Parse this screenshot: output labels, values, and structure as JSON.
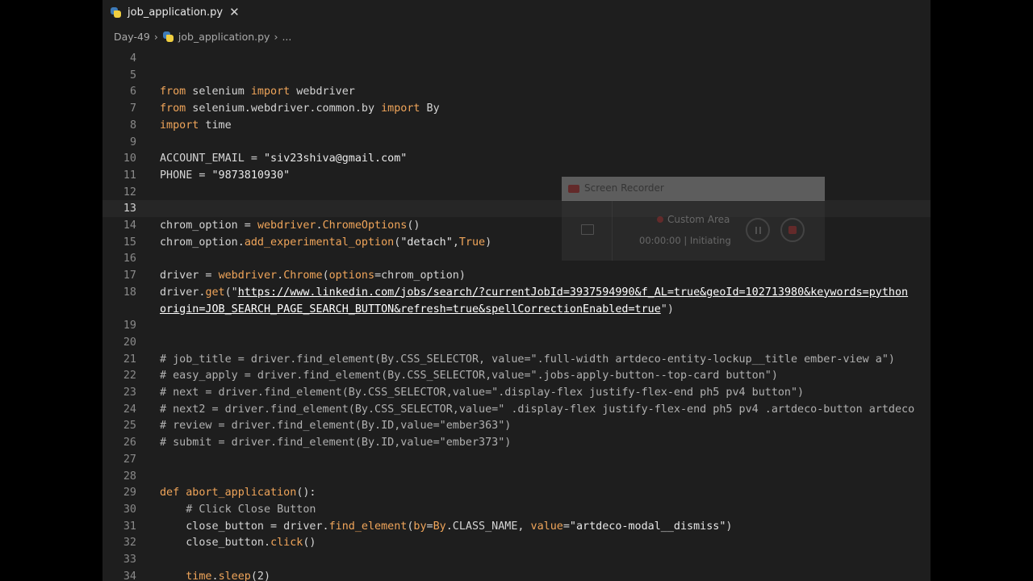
{
  "tab": {
    "filename": "job_application.py",
    "close_glyph": "✕",
    "icon": "python-icon"
  },
  "breadcrumb": {
    "folder": "Day-49",
    "file": "job_application.py",
    "chevron": "›",
    "ellipsis": "..."
  },
  "active_line": 13,
  "lines": [
    {
      "n": "4",
      "tokens": []
    },
    {
      "n": "5",
      "tokens": []
    },
    {
      "n": "6",
      "tokens": [
        [
          "kw",
          "from"
        ],
        [
          "p",
          " selenium "
        ],
        [
          "kw",
          "import"
        ],
        [
          "p",
          " webdriver"
        ]
      ]
    },
    {
      "n": "7",
      "tokens": [
        [
          "kw",
          "from"
        ],
        [
          "p",
          " selenium.webdriver.common.by "
        ],
        [
          "kw",
          "import"
        ],
        [
          "p",
          " By"
        ]
      ]
    },
    {
      "n": "8",
      "tokens": [
        [
          "kw",
          "import"
        ],
        [
          "p",
          " time"
        ]
      ]
    },
    {
      "n": "9",
      "tokens": []
    },
    {
      "n": "10",
      "tokens": [
        [
          "p",
          "ACCOUNT_EMAIL = "
        ],
        [
          "str",
          "\"siv23shiva@gmail.com\""
        ]
      ]
    },
    {
      "n": "11",
      "tokens": [
        [
          "p",
          "PHONE = "
        ],
        [
          "str",
          "\"9873810930\""
        ]
      ]
    },
    {
      "n": "12",
      "tokens": []
    },
    {
      "n": "13",
      "tokens": []
    },
    {
      "n": "14",
      "tokens": [
        [
          "p",
          "chrom_option = "
        ],
        [
          "fn",
          "webdriver"
        ],
        [
          "p",
          "."
        ],
        [
          "fn",
          "ChromeOptions"
        ],
        [
          "p",
          "()"
        ]
      ]
    },
    {
      "n": "15",
      "tokens": [
        [
          "p",
          "chrom_option."
        ],
        [
          "fn",
          "add_experimental_option"
        ],
        [
          "p",
          "("
        ],
        [
          "str",
          "\"detach\""
        ],
        [
          "p",
          ","
        ],
        [
          "kw",
          "True"
        ],
        [
          "p",
          ")"
        ]
      ]
    },
    {
      "n": "16",
      "tokens": []
    },
    {
      "n": "17",
      "tokens": [
        [
          "p",
          "driver = "
        ],
        [
          "fn",
          "webdriver"
        ],
        [
          "p",
          "."
        ],
        [
          "fn",
          "Chrome"
        ],
        [
          "p",
          "("
        ],
        [
          "kw",
          "options"
        ],
        [
          "p",
          "=chrom_option)"
        ]
      ]
    },
    {
      "n": "18",
      "tokens": [
        [
          "p",
          "driver."
        ],
        [
          "fn",
          "get"
        ],
        [
          "p",
          "(\""
        ],
        [
          "url",
          "https://www.linkedin.com/jobs/search/?currentJobId=3937594990&f_AL=true&geoId=102713980&keywords=python"
        ]
      ]
    },
    {
      "n": "",
      "tokens": [
        [
          "url",
          "origin=JOB_SEARCH_PAGE_SEARCH_BUTTON&refresh=true&spellCorrectionEnabled=true"
        ],
        [
          "p",
          "\")"
        ]
      ]
    },
    {
      "n": "19",
      "tokens": []
    },
    {
      "n": "20",
      "tokens": []
    },
    {
      "n": "21",
      "tokens": [
        [
          "cm",
          "# job_title = driver.find_element(By.CSS_SELECTOR, value=\".full-width artdeco-entity-lockup__title ember-view a\")"
        ]
      ]
    },
    {
      "n": "22",
      "tokens": [
        [
          "cm",
          "# easy_apply = driver.find_element(By.CSS_SELECTOR,value=\".jobs-apply-button--top-card button\")"
        ]
      ]
    },
    {
      "n": "23",
      "tokens": [
        [
          "cm",
          "# next = driver.find_element(By.CSS_SELECTOR,value=\".display-flex justify-flex-end ph5 pv4 button\")"
        ]
      ]
    },
    {
      "n": "24",
      "tokens": [
        [
          "cm",
          "# next2 = driver.find_element(By.CSS_SELECTOR,value=\" .display-flex justify-flex-end ph5 pv4 .artdeco-button artdeco"
        ]
      ]
    },
    {
      "n": "25",
      "tokens": [
        [
          "cm",
          "# review = driver.find_element(By.ID,value=\"ember363\")"
        ]
      ]
    },
    {
      "n": "26",
      "tokens": [
        [
          "cm",
          "# submit = driver.find_element(By.ID,value=\"ember373\")"
        ]
      ]
    },
    {
      "n": "27",
      "tokens": []
    },
    {
      "n": "28",
      "tokens": []
    },
    {
      "n": "29",
      "tokens": [
        [
          "def",
          "def"
        ],
        [
          "p",
          " "
        ],
        [
          "fn",
          "abort_application"
        ],
        [
          "p",
          "():"
        ]
      ]
    },
    {
      "n": "30",
      "tokens": [
        [
          "p",
          "    "
        ],
        [
          "cm",
          "# Click Close Button"
        ]
      ]
    },
    {
      "n": "31",
      "tokens": [
        [
          "p",
          "    close_button = driver."
        ],
        [
          "fn",
          "find_element"
        ],
        [
          "p",
          "("
        ],
        [
          "kw",
          "by"
        ],
        [
          "p",
          "="
        ],
        [
          "cls",
          "By"
        ],
        [
          "p",
          ".CLASS_NAME, "
        ],
        [
          "kw",
          "value"
        ],
        [
          "p",
          "="
        ],
        [
          "str",
          "\"artdeco-modal__dismiss\""
        ],
        [
          "p",
          ")"
        ]
      ]
    },
    {
      "n": "32",
      "tokens": [
        [
          "p",
          "    close_button."
        ],
        [
          "fn",
          "click"
        ],
        [
          "p",
          "()"
        ]
      ]
    },
    {
      "n": "33",
      "tokens": []
    },
    {
      "n": "34",
      "tokens": [
        [
          "p",
          "    "
        ],
        [
          "fn",
          "time"
        ],
        [
          "p",
          "."
        ],
        [
          "fn",
          "sleep"
        ],
        [
          "p",
          "(2)"
        ]
      ]
    }
  ],
  "recorder": {
    "title": "Screen Recorder",
    "area_label": "Custom Area",
    "time": "00:00:00",
    "status_sep": "|",
    "status": "Initiating"
  }
}
